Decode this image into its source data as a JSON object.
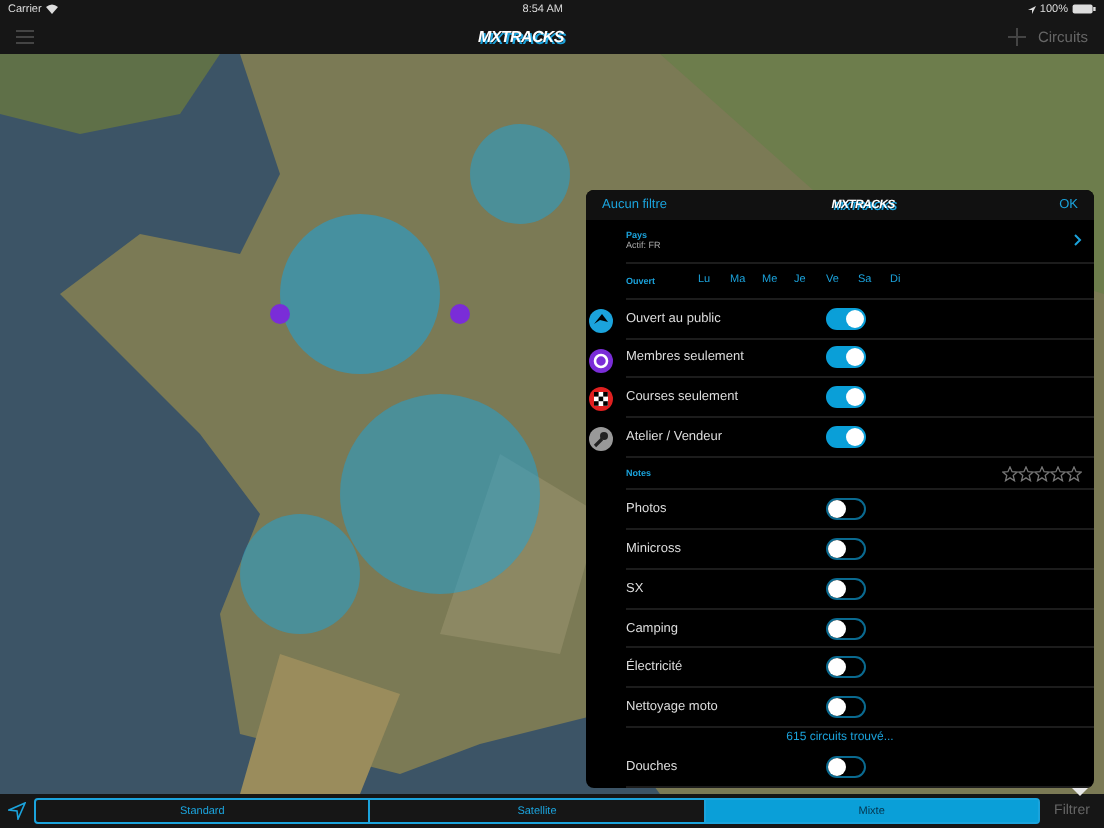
{
  "status_bar": {
    "carrier": "Carrier",
    "time": "8:54 AM",
    "battery": "100%"
  },
  "nav_bar": {
    "logo": "MXTRACKS",
    "action": "Circuits"
  },
  "filter_panel": {
    "reset": "Aucun filtre",
    "logo": "MXTRACKS",
    "ok": "OK",
    "country": {
      "label": "Pays",
      "value": "Actif: FR"
    },
    "open": {
      "label": "Ouvert",
      "days": [
        "Lu",
        "Ma",
        "Me",
        "Je",
        "Ve",
        "Sa",
        "Di"
      ]
    },
    "types": [
      {
        "label": "Ouvert au public",
        "on": true,
        "kind": "public"
      },
      {
        "label": "Membres seulement",
        "on": true,
        "kind": "members"
      },
      {
        "label": "Courses seulement",
        "on": true,
        "kind": "races"
      },
      {
        "label": "Atelier / Vendeur",
        "on": true,
        "kind": "shop"
      }
    ],
    "notes": {
      "label": "Notes",
      "stars": 0
    },
    "amenities": [
      {
        "label": "Photos",
        "on": false
      },
      {
        "label": "Minicross",
        "on": false
      },
      {
        "label": "SX",
        "on": false
      },
      {
        "label": "Camping",
        "on": false
      },
      {
        "label": "Électricité",
        "on": false
      },
      {
        "label": "Nettoyage moto",
        "on": false
      },
      {
        "label": "Douches",
        "on": false
      }
    ],
    "result": "615 circuits trouvé..."
  },
  "bottom_bar": {
    "modes": [
      {
        "label": "Standard",
        "selected": false
      },
      {
        "label": "Satellite",
        "selected": false
      },
      {
        "label": "Mixte",
        "selected": true
      }
    ],
    "filter": "Filtrer"
  }
}
